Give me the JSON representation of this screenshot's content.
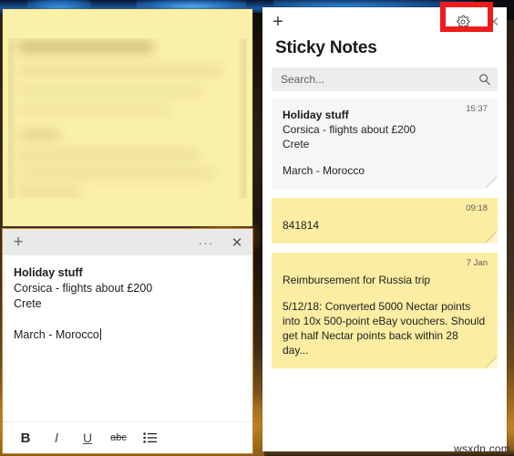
{
  "desktop": {
    "watermark": "wsxdn.com"
  },
  "blurred_note": {
    "name": "blurred sticky note",
    "background_color": "#fbf0a8",
    "content_state": "blurred"
  },
  "note_editor": {
    "titlebar": {
      "add_label": "+",
      "more_label": "···",
      "close_label": "✕"
    },
    "lines": [
      {
        "text": "Holiday stuff",
        "bold": true
      },
      {
        "text": "Corsica - flights about £200",
        "bold": false
      },
      {
        "text": "Crete",
        "bold": false
      },
      {
        "text": "",
        "bold": false
      },
      {
        "text": "March - Morocco",
        "bold": false
      }
    ],
    "caret_after": "March - Morocco",
    "toolbar": {
      "bold_label": "B",
      "italic_label": "I",
      "underline_label": "U",
      "strikethrough_label": "abc",
      "bullets_label": "bullet-list"
    }
  },
  "notes_panel": {
    "titlebar": {
      "add_label": "+",
      "settings_label": "gear",
      "close_label": "✕"
    },
    "app_title": "Sticky Notes",
    "search": {
      "placeholder": "Search...",
      "value": ""
    },
    "notes": [
      {
        "color": "white",
        "timestamp": "15:37",
        "title": "Holiday stuff",
        "lines": [
          "Corsica - flights about £200",
          "Crete",
          "",
          "March - Morocco"
        ]
      },
      {
        "color": "yellow",
        "timestamp": "09:18",
        "title": "",
        "lines": [
          "841814"
        ]
      },
      {
        "color": "yellow",
        "timestamp": "7 Jan",
        "title": "",
        "lines": [
          "Reimbursement for Russia trip",
          "",
          "5/12/18: Converted 5000 Nectar points",
          "into 10x 500-point eBay vouchers. Should",
          "get half Nectar points back within 28 day..."
        ]
      }
    ]
  },
  "annotation": {
    "highlight_color": "#ee1c1c",
    "target": "settings-gear-button"
  }
}
